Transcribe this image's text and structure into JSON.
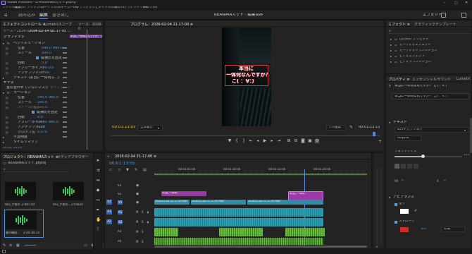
{
  "window": {
    "title": "Adobe Premiere - D:¥REANIMAカット.prproj *"
  },
  "menu": [
    "ファイル(F)",
    "編集(E)",
    "クリップ(C)",
    "シーケンス(S)",
    "マーカー(M)",
    "グラフィックとタイトル(G)",
    "表示(V)",
    "ウィンドウ(W)",
    "ヘルプ(H)"
  ],
  "workspace": {
    "tabs": [
      "ホーム",
      "読み込み",
      "編集",
      "書き出し"
    ],
    "active": 2,
    "center_title": "REANIMAカット - 編集済み",
    "right_label": "エフェクト"
  },
  "effect_controls": {
    "tabs": [
      "エフェクトコントロール ≡",
      "Lumetriスコープ",
      "ソース：2026-0"
    ],
    "source": "ソース・2026-02-04 21-17-00...",
    "timecode_clip": "2026-02-04 21-17-00 ...",
    "clip_label": "本当に一体何なんですか？ (：∀：)",
    "section_graphic": "グラフィック",
    "section_video": "ビデオ",
    "rows": [
      {
        "label": "ベクトルモーション",
        "value": "",
        "indent": 1
      },
      {
        "label": "位置",
        "value": "540.0   960.0",
        "indent": 2
      },
      {
        "label": "スケール",
        "value": "100.0",
        "indent": 2
      },
      {
        "label": "",
        "value": "縦横比を固定",
        "indent": 3
      },
      {
        "label": "回転",
        "value": "0.0",
        "indent": 2
      },
      {
        "label": "アンカーポイント",
        "value": "0.0   0.0",
        "indent": 2
      },
      {
        "label": "アンチフリッカー",
        "value": "0.00",
        "indent": 2
      },
      {
        "label": "テキスト (本当に一体何な...)",
        "value": "",
        "indent": 1
      },
      {
        "label": "重ね合わせていないマスク",
        "value": "すべてクリア",
        "indent": 1
      },
      {
        "label": "モーション",
        "value": "",
        "indent": 1
      },
      {
        "label": "位置",
        "value": "540.0   960.0",
        "indent": 2
      },
      {
        "label": "スケール",
        "value": "100.0",
        "indent": 2
      },
      {
        "label": "スケール(幅)",
        "value": "100.0",
        "indent": 2
      },
      {
        "label": "",
        "value": "縦横比を固定",
        "indent": 3
      },
      {
        "label": "回転",
        "value": "0.0",
        "indent": 2
      },
      {
        "label": "アンカーポイント",
        "value": "540.0   960.0",
        "indent": 2
      },
      {
        "label": "アンチフリッカー",
        "value": "0.00",
        "indent": 2
      },
      {
        "label": "クロップ左",
        "value": "0.0 %",
        "indent": 2
      },
      {
        "label": "不透明度",
        "value": "",
        "indent": 1
      },
      {
        "label": "タイムリマップ",
        "value": "",
        "indent": 1
      }
    ],
    "bottom_timecode": "00:01:13:05"
  },
  "program": {
    "tab": "プログラム：2026-02-04 21-17-00 ≡",
    "text_lines": [
      "本当に",
      "一体何なんですか？",
      "こ( ：∀：)"
    ],
    "timecode": "00:01:13:05",
    "fit": "全体表示",
    "quality": "フル画質",
    "duration": "00:01:13:11",
    "controls": [
      "marker",
      "in",
      "out",
      "goto-in",
      "step-back",
      "play",
      "step-forward",
      "goto-out",
      "insert",
      "overwrite",
      "export-frame",
      "compare",
      "settings"
    ]
  },
  "project": {
    "tabs": [
      "プロジェクト：REANIMAカット ≡",
      "メディアブラウザー"
    ],
    "path": "REANIMAカット.prproj",
    "items": [
      {
        "name": "003_手前の...",
        "duration": "2:40:150",
        "color": "#38c45a"
      },
      {
        "name": "003_手前の...",
        "duration": "2:45824",
        "color": "#38c45a"
      },
      {
        "name": "最の構成...",
        "duration": "2:30:30110",
        "color": "#38c45a"
      }
    ]
  },
  "timeline": {
    "tab": "2026-02-04 21-17-00 ≡",
    "timecode": "00:01:13:05",
    "ruler": [
      "00:01:05:00",
      "00:01:10:00",
      "00:01:15:00",
      "00:01:20:00"
    ],
    "tracks": [
      {
        "name": "V3",
        "type": "video"
      },
      {
        "name": "V2",
        "type": "video"
      },
      {
        "name": "V1",
        "type": "video"
      },
      {
        "name": "A1",
        "type": "audio"
      },
      {
        "name": "A2",
        "type": "audio"
      },
      {
        "name": "A3",
        "type": "audio"
      },
      {
        "name": "A4",
        "type": "audio"
      }
    ],
    "clips": [
      {
        "track": "V2",
        "label": "本当に一体何...",
        "kind": "pclip"
      },
      {
        "track": "V2",
        "label": "本当に一体何...",
        "kind": "pclip"
      },
      {
        "track": "V1",
        "label": "2026-02-04 21-17-00.mp4",
        "kind": "vclip"
      },
      {
        "track": "V1",
        "label": "2026-02-04 21-17-00.mp4",
        "kind": "vclip"
      },
      {
        "track": "V1",
        "label": "2026-02-04 21-17-00.mp4",
        "kind": "vclip"
      }
    ]
  },
  "effects_panel": {
    "tabs": [
      "エフェクト ≡",
      "グラフィックテンプレート"
    ],
    "items": [
      "Lumetri プリセット",
      "オーディオエフェクト",
      "オーディオトランジション",
      "ビデオエフェクト",
      "ビデオトランジション"
    ]
  },
  "properties": {
    "tabs": [
      "プロパティ ≡",
      "エッセンシャルサウンド",
      "Lumetri"
    ],
    "clip_name": "本当に一体何なんですか？ こ( ：∀：)",
    "text_content": "本当に一体何なんですか？ こ( ：∀：)",
    "section_text": "テキスト",
    "font": "851チカラヅヨク",
    "style": "Regular",
    "font_size_label": "フォントサイズ",
    "font_size_value": "125",
    "tracking_value": "0",
    "leading_value": "0",
    "section_appearance": "アピアランス",
    "fill_label": "塗り",
    "stroke_label": "ストローク",
    "stroke_value": "8.0",
    "stroke_position": "外側"
  }
}
